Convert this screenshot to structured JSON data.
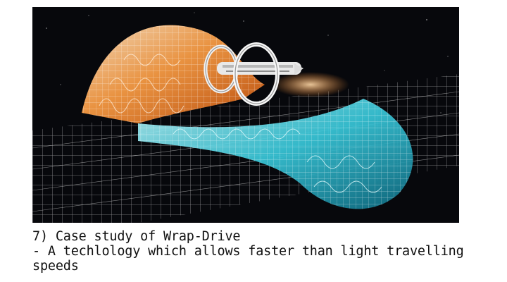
{
  "slide": {
    "image": {
      "subject": "warp-drive-spacecraft-spacetime-grid",
      "colors": {
        "background": "#07080c",
        "warm_wave": "#f07a22",
        "cool_wave": "#3fd0e0",
        "grid": "#e8e8e8"
      }
    },
    "caption": {
      "line1": "7) Case study of Wrap-Drive",
      "line2": "- A techlology which allows faster than light travelling",
      "line3": "speeds"
    }
  }
}
